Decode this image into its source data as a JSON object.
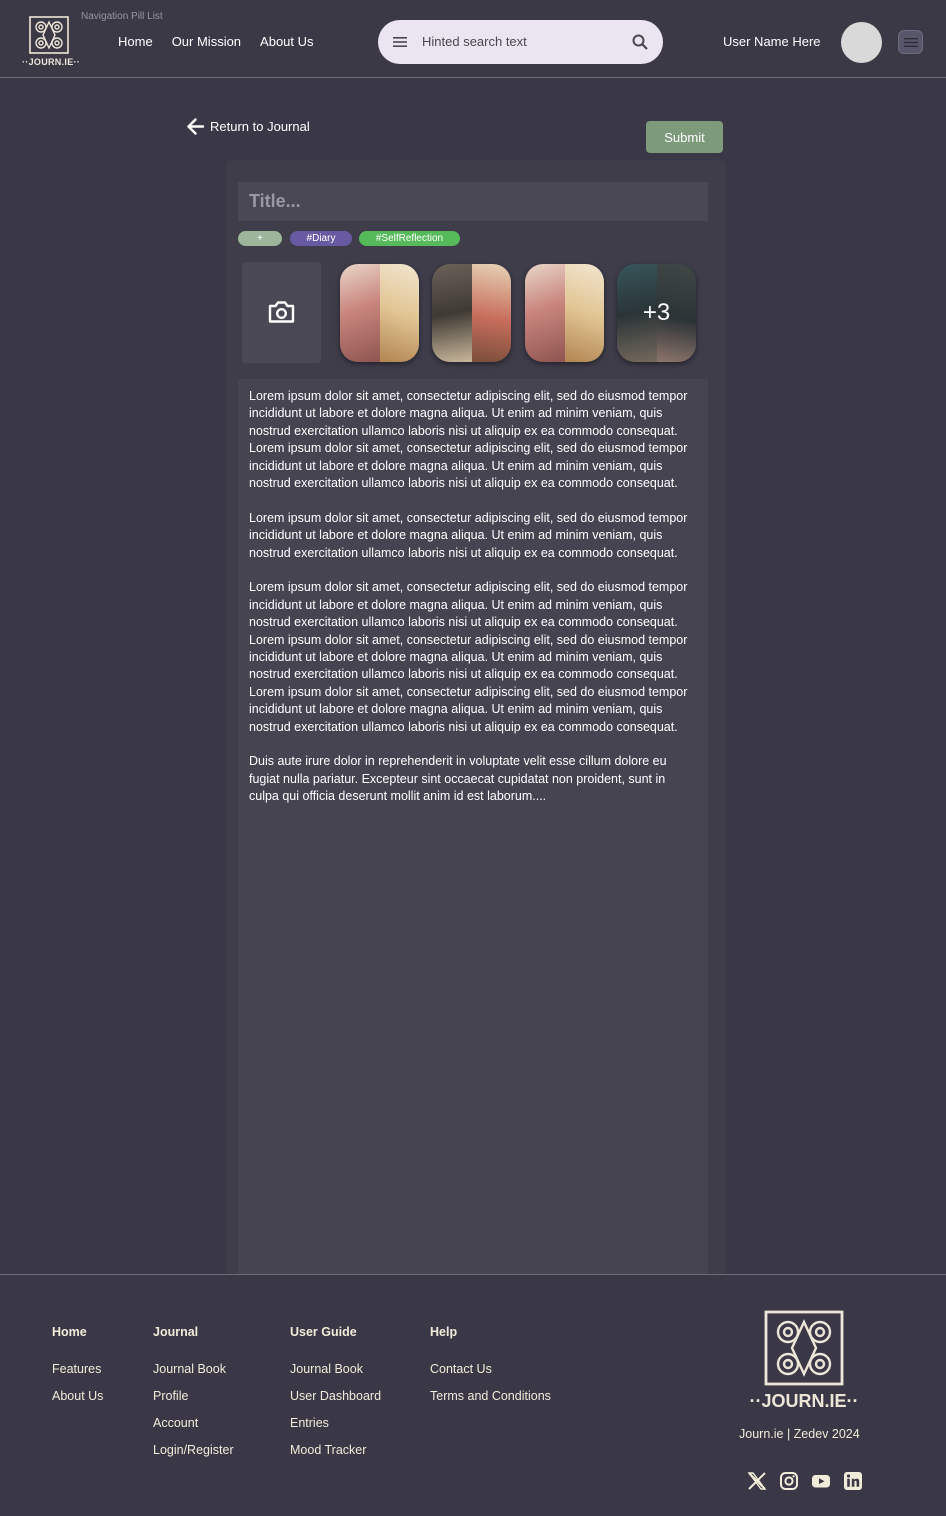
{
  "header": {
    "pill_caption": "Navigation Pill List",
    "logo_text": "··JOURN.IE··",
    "nav": [
      "Home",
      "Our Mission",
      "About Us"
    ],
    "search_placeholder": "Hinted search text",
    "user_name": "User Name Here"
  },
  "main": {
    "return_label": "Return to Journal",
    "submit_label": "Submit",
    "title_placeholder": "Title...",
    "tags": [
      "+",
      "#Diary",
      "#SelfReflection"
    ],
    "extra_images_label": "+3",
    "paragraphs": [
      "Lorem ipsum dolor sit amet, consectetur adipiscing elit, sed do eiusmod tempor incididunt ut labore et dolore magna aliqua. Ut enim ad minim veniam, quis nostrud exercitation ullamco laboris nisi ut aliquip ex ea commodo consequat. Lorem ipsum dolor sit amet, consectetur adipiscing elit, sed do eiusmod tempor incididunt ut labore et dolore magna aliqua. Ut enim ad minim veniam, quis nostrud exercitation ullamco laboris nisi ut aliquip ex ea commodo consequat.",
      "Lorem ipsum dolor sit amet, consectetur adipiscing elit, sed do eiusmod tempor incididunt ut labore et dolore magna aliqua. Ut enim ad minim veniam, quis nostrud exercitation ullamco laboris nisi ut aliquip ex ea commodo consequat.",
      "Lorem ipsum dolor sit amet, consectetur adipiscing elit, sed do eiusmod tempor incididunt ut labore et dolore magna aliqua. Ut enim ad minim veniam, quis nostrud exercitation ullamco laboris nisi ut aliquip ex ea commodo consequat. Lorem ipsum dolor sit amet, consectetur adipiscing elit, sed do eiusmod tempor incididunt ut labore et dolore magna aliqua. Ut enim ad minim veniam, quis nostrud exercitation ullamco laboris nisi ut aliquip ex ea commodo consequat. Lorem ipsum dolor sit amet, consectetur adipiscing elit, sed do eiusmod tempor incididunt ut labore et dolore magna aliqua. Ut enim ad minim veniam, quis nostrud exercitation ullamco laboris nisi ut aliquip ex ea commodo consequat.",
      "Duis aute irure dolor in reprehenderit in voluptate velit esse cillum dolore eu fugiat nulla pariatur. Excepteur sint occaecat cupidatat non proident, sunt in culpa qui officia deserunt mollit anim id est laborum...."
    ]
  },
  "footer": {
    "columns": [
      {
        "heading": "Home",
        "links": [
          "Features",
          "About Us"
        ]
      },
      {
        "heading": "Journal",
        "links": [
          "Journal Book",
          "Profile",
          "Account",
          "Login/Register"
        ]
      },
      {
        "heading": "User Guide",
        "links": [
          "Journal Book",
          "User Dashboard",
          "Entries",
          "Mood Tracker"
        ]
      },
      {
        "heading": "Help",
        "links": [
          "Contact Us",
          "Terms and Conditions"
        ]
      }
    ],
    "logo_text": "··JOURN.IE··",
    "copyright": "Journ.ie | Zedev 2024",
    "socials": [
      "x-icon",
      "instagram-icon",
      "youtube-icon",
      "linkedin-icon"
    ]
  },
  "colors": {
    "background": "#3a3847",
    "card": "#3f3d4a",
    "panel": "#474452",
    "submit": "#7d9a7b",
    "tag_add": "#9db59b",
    "tag_diary": "#685aa2",
    "tag_self": "#56b95a",
    "search_bg": "#ebe5f2",
    "cream_text": "#f1ebd9"
  }
}
